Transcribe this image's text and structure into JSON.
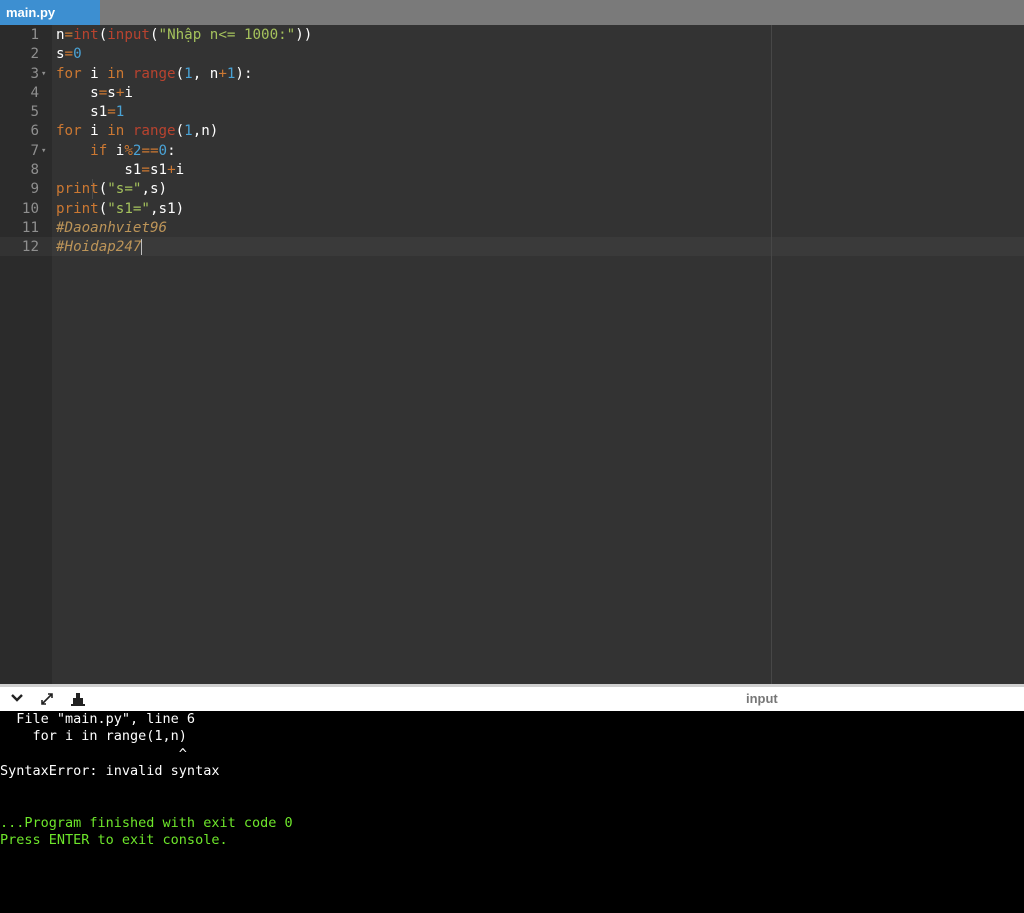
{
  "tab": {
    "label": "main.py"
  },
  "editor": {
    "lines": [
      {
        "num": "1",
        "fold": "",
        "tokens": [
          [
            "id",
            "n"
          ],
          [
            "op",
            "="
          ],
          [
            "bi",
            "int"
          ],
          [
            "id",
            "("
          ],
          [
            "bi",
            "input"
          ],
          [
            "id",
            "("
          ],
          [
            "str",
            "\"Nhập n<= 1000:\""
          ],
          [
            "id",
            "))"
          ]
        ]
      },
      {
        "num": "2",
        "fold": "",
        "tokens": [
          [
            "id",
            "s"
          ],
          [
            "op",
            "="
          ],
          [
            "num",
            "0"
          ]
        ]
      },
      {
        "num": "3",
        "fold": "▾",
        "tokens": [
          [
            "kw",
            "for"
          ],
          [
            "id",
            " i "
          ],
          [
            "kw",
            "in"
          ],
          [
            "id",
            " "
          ],
          [
            "bi",
            "range"
          ],
          [
            "id",
            "("
          ],
          [
            "num",
            "1"
          ],
          [
            "id",
            ", n"
          ],
          [
            "op",
            "+"
          ],
          [
            "num",
            "1"
          ],
          [
            "id",
            "):"
          ]
        ]
      },
      {
        "num": "4",
        "fold": "",
        "tokens": [
          [
            "id",
            "    s"
          ],
          [
            "op",
            "="
          ],
          [
            "id",
            "s"
          ],
          [
            "op",
            "+"
          ],
          [
            "id",
            "i"
          ]
        ]
      },
      {
        "num": "5",
        "fold": "",
        "tokens": [
          [
            "id",
            "    s1"
          ],
          [
            "op",
            "="
          ],
          [
            "num",
            "1"
          ]
        ]
      },
      {
        "num": "6",
        "fold": "",
        "tokens": [
          [
            "kw",
            "for"
          ],
          [
            "id",
            " i "
          ],
          [
            "kw",
            "in"
          ],
          [
            "id",
            " "
          ],
          [
            "bi",
            "range"
          ],
          [
            "id",
            "("
          ],
          [
            "num",
            "1"
          ],
          [
            "id",
            ",n)"
          ]
        ]
      },
      {
        "num": "7",
        "fold": "▾",
        "tokens": [
          [
            "id",
            "    "
          ],
          [
            "kw",
            "if"
          ],
          [
            "id",
            " i"
          ],
          [
            "op",
            "%"
          ],
          [
            "num",
            "2"
          ],
          [
            "op",
            "=="
          ],
          [
            "num",
            "0"
          ],
          [
            "id",
            ":"
          ]
        ]
      },
      {
        "num": "8",
        "fold": "",
        "tokens": [
          [
            "id",
            "        s1"
          ],
          [
            "op",
            "="
          ],
          [
            "id",
            "s1"
          ],
          [
            "op",
            "+"
          ],
          [
            "id",
            "i"
          ]
        ]
      },
      {
        "num": "9",
        "fold": "",
        "tokens": [
          [
            "kw",
            "print"
          ],
          [
            "id",
            "("
          ],
          [
            "str",
            "\"s=\""
          ],
          [
            "id",
            ",s)"
          ]
        ]
      },
      {
        "num": "10",
        "fold": "",
        "tokens": [
          [
            "kw",
            "print"
          ],
          [
            "id",
            "("
          ],
          [
            "str",
            "\"s1=\""
          ],
          [
            "id",
            ",s1)"
          ]
        ]
      },
      {
        "num": "11",
        "fold": "",
        "tokens": [
          [
            "cm",
            "#Daoanhviet96"
          ]
        ]
      },
      {
        "num": "12",
        "fold": "",
        "tokens": [
          [
            "cm",
            "#Hoidap247"
          ]
        ]
      }
    ]
  },
  "console_bar": {
    "icons": [
      "chevron-down-icon",
      "expand-icon",
      "clear-icon"
    ],
    "input_label": "input"
  },
  "console": {
    "lines": [
      {
        "text": "  File \"main.py\", line 6",
        "color": "#ffffff"
      },
      {
        "text": "    for i in range(1,n)",
        "color": "#ffffff"
      },
      {
        "text": "                      ^",
        "color": "#ffffff"
      },
      {
        "text": "SyntaxError: invalid syntax",
        "color": "#ffffff"
      },
      {
        "text": "",
        "color": "#ffffff"
      },
      {
        "text": "",
        "color": "#ffffff"
      },
      {
        "text": "...Program finished with exit code 0",
        "color": "#6ee62b"
      },
      {
        "text": "Press ENTER to exit console.",
        "color": "#6ee62b"
      }
    ]
  }
}
